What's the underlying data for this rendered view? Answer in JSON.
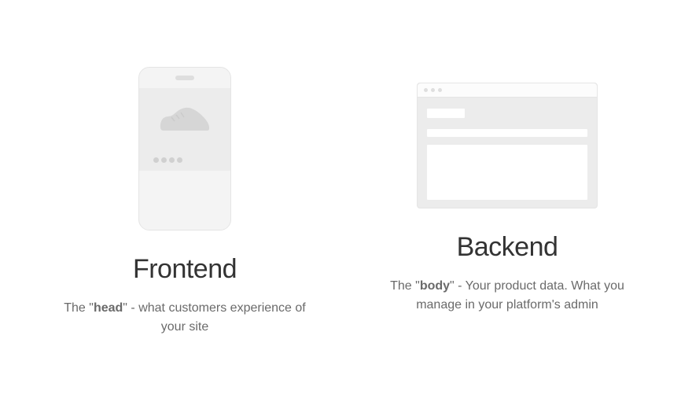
{
  "frontend": {
    "title": "Frontend",
    "desc_prefix": "The \"",
    "desc_bold": "head",
    "desc_suffix": "\" - what customers experience of your site"
  },
  "backend": {
    "title": "Backend",
    "desc_prefix": "The \"",
    "desc_bold": "body",
    "desc_suffix": "\" - Your product data. What you manage in your platform's admin"
  }
}
